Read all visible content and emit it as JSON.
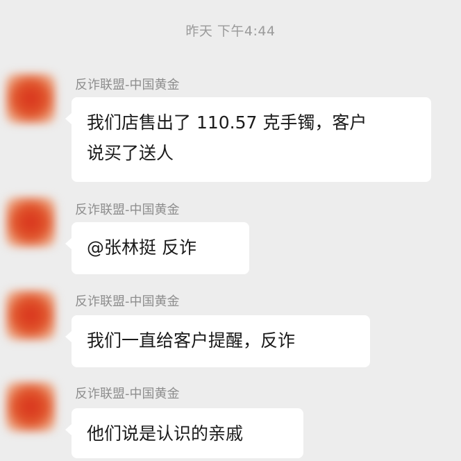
{
  "chat": {
    "timestamp": "昨天 下午4:44",
    "messages": [
      {
        "sender": "反诈联盟-中国黄金",
        "lines": [
          "我们店售出了 110.57 克手镯，客户",
          "说买了送人"
        ]
      },
      {
        "sender": "反诈联盟-中国黄金",
        "lines": [
          "@张林挺 反诈"
        ]
      },
      {
        "sender": "反诈联盟-中国黄金",
        "lines": [
          "我们一直给客户提醒，反诈"
        ]
      },
      {
        "sender": "反诈联盟-中国黄金",
        "lines": [
          "他们说是认识的亲戚"
        ]
      }
    ]
  },
  "colors": {
    "background": "#ededed",
    "bubble": "#ffffff",
    "avatar_red": "#d8321c"
  },
  "icons": {
    "avatar": "blurred-red-avatar-icon"
  }
}
